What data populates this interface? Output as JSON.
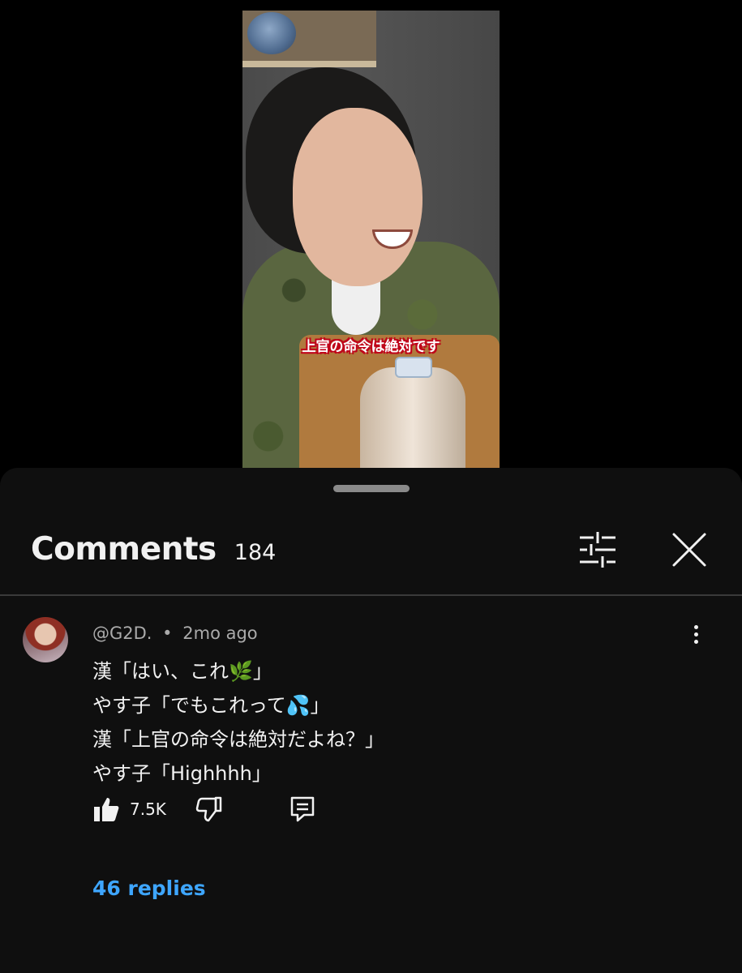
{
  "video": {
    "caption": "上官の命令は絶対です"
  },
  "comments_panel": {
    "title": "Comments",
    "count": "184",
    "filter_icon": "sliders-icon",
    "close_icon": "close-icon"
  },
  "comment": {
    "author": "@G2D.",
    "separator": "•",
    "time": "2mo ago",
    "lines": [
      "漢「はい、これ🌿」",
      "やす子「でもこれって💦」",
      "漢「上官の命令は絶対だよね？」",
      "やす子「Highhhh」"
    ],
    "like_count": "7.5K",
    "replies_label": "46 replies"
  },
  "colors": {
    "sheet_bg": "#0f0f0f",
    "link_blue": "#3ea6ff",
    "meta_gray": "#aaaaaa"
  }
}
